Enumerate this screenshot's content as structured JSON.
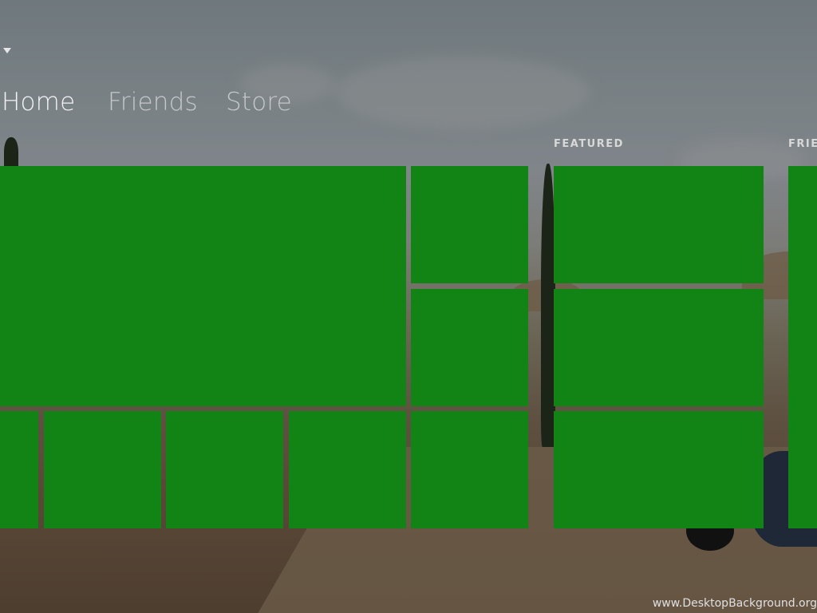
{
  "theme": {
    "tile_color": "#128315"
  },
  "nav": {
    "tabs": [
      {
        "label": "Home",
        "active": true
      },
      {
        "label": "Friends",
        "active": false
      },
      {
        "label": "Store",
        "active": false
      }
    ]
  },
  "sections": {
    "featured_label": "FEATURED",
    "friends_label": "FRIEN"
  },
  "watermark": "www.DesktopBackground.org",
  "icons": {
    "menu_caret": "caret-down-icon"
  }
}
